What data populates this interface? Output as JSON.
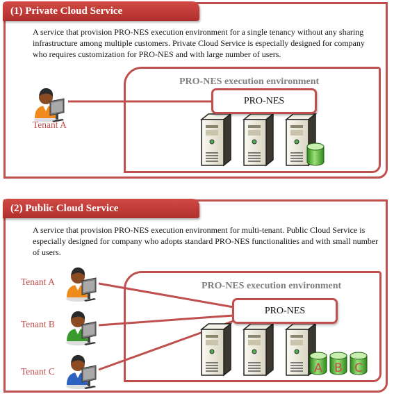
{
  "sections": [
    {
      "header": "(1) Private Cloud Service",
      "description": "A service that provision PRO-NES  execution environment for a single tenancy without any sharing infrastructure among multiple customers. Private Cloud Service is especially designed for company who requires customization for PRO-NES  and with large number of users.",
      "environment_title": "PRO-NES execution environment",
      "app_label": "PRO-NES",
      "tenants": [
        {
          "label": "Tenant A",
          "shirt_color": "#f08a1c"
        }
      ],
      "servers": 3,
      "databases": [
        ""
      ]
    },
    {
      "header": "(2) Public Cloud Service",
      "description": "A service that provision PRO-NES  execution environment for multi-tenant.  Public Cloud Service is especially designed for company who adopts standard PRO-NES  functionalities and with small number of users.",
      "environment_title": "PRO-NES execution environment",
      "app_label": "PRO-NES",
      "tenants": [
        {
          "label": "Tenant A",
          "shirt_color": "#f08a1c"
        },
        {
          "label": "Tenant B",
          "shirt_color": "#3a9a2e"
        },
        {
          "label": "Tenant C",
          "shirt_color": "#2d62c0"
        }
      ],
      "servers": 3,
      "databases": [
        "A",
        "B",
        "C"
      ]
    }
  ],
  "colors": {
    "accent": "#c0504d",
    "env_title": "#7f7f7f",
    "db_green": "#5cb335"
  }
}
